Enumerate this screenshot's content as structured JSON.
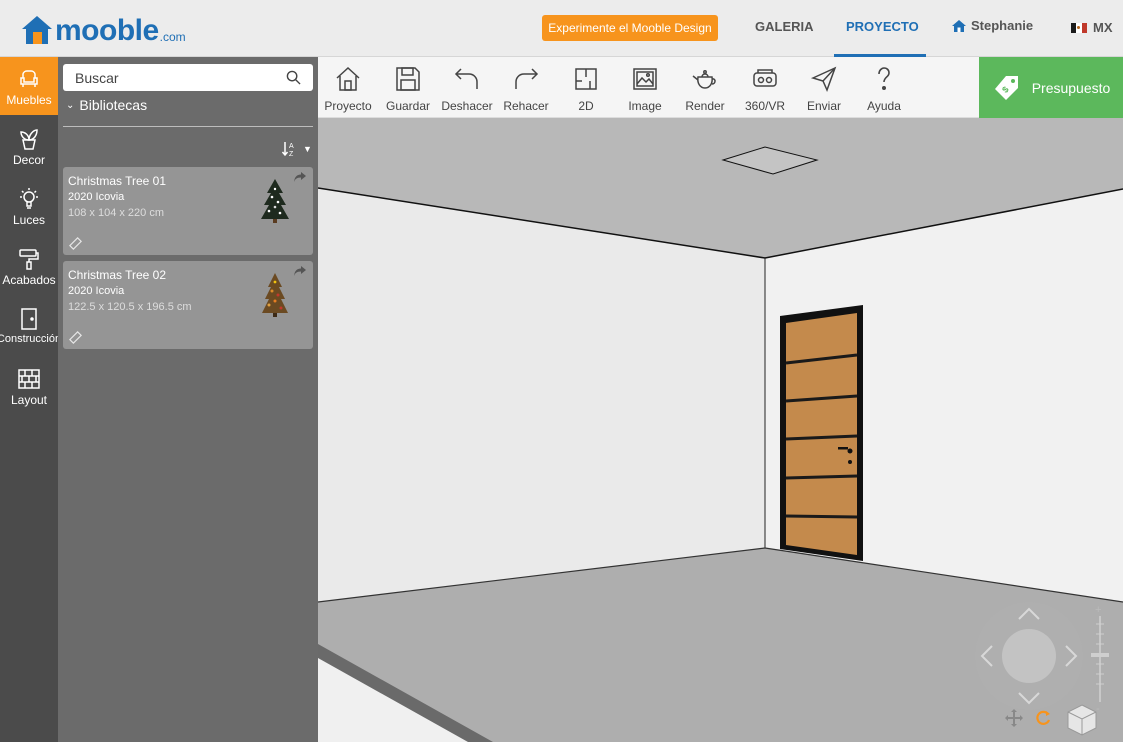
{
  "header": {
    "logo_text": "mooble",
    "logo_domain": ".com",
    "cta_label": "Experimente el Mooble Design",
    "nav": {
      "galeria": "GALERIA",
      "proyecto": "PROYECTO"
    },
    "user_name": "Stephanie",
    "language": "MX"
  },
  "sidebar": {
    "items": [
      {
        "label": "Muebles",
        "icon": "armchair-icon",
        "active": true
      },
      {
        "label": "Decor",
        "icon": "plant-icon"
      },
      {
        "label": "Luces",
        "icon": "lightbulb-icon"
      },
      {
        "label": "Acabados",
        "icon": "paint-roller-icon"
      },
      {
        "label": "Construcción",
        "icon": "door-icon"
      },
      {
        "label": "Layout",
        "icon": "grid-icon"
      }
    ]
  },
  "library": {
    "search_placeholder": "Buscar",
    "section_label": "Bibliotecas",
    "items": [
      {
        "title": "Christmas Tree 01",
        "brand": "2020 Icovia",
        "dimensions": "108 x 104 x 220 cm"
      },
      {
        "title": "Christmas Tree 02",
        "brand": "2020 Icovia",
        "dimensions": "122.5 x 120.5 x 196.5 cm"
      }
    ]
  },
  "toolbar": {
    "tools": [
      {
        "label": "Proyecto",
        "icon": "house-icon"
      },
      {
        "label": "Guardar",
        "icon": "floppy-icon"
      },
      {
        "label": "Deshacer",
        "icon": "undo-icon"
      },
      {
        "label": "Rehacer",
        "icon": "redo-icon"
      },
      {
        "label": "2D",
        "icon": "floorplan-icon"
      },
      {
        "label": "Image",
        "icon": "image-icon"
      },
      {
        "label": "Render",
        "icon": "teapot-icon"
      },
      {
        "label": "360/VR",
        "icon": "vr-headset-icon"
      },
      {
        "label": "Enviar",
        "icon": "paper-plane-icon"
      },
      {
        "label": "Ayuda",
        "icon": "question-icon"
      }
    ],
    "budget_label": "Presupuesto"
  },
  "colors": {
    "brand_blue": "#1f6fb5",
    "accent_orange": "#f7941d",
    "budget_green": "#5cb85c",
    "sidebar_dark": "#4b4b4b",
    "panel_gray": "#6b6b6b"
  }
}
